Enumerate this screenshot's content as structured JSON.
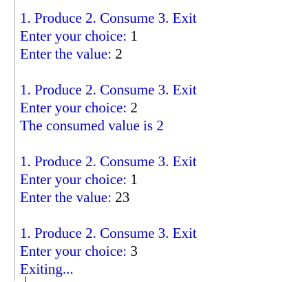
{
  "console": {
    "blocks": [
      {
        "menu": "1. Produce 2. Consume 3. Exit",
        "prompt": "Enter your choice: ",
        "choice": "1",
        "result_label": "Enter the value: ",
        "result_value": "2"
      },
      {
        "menu": "1. Produce 2. Consume 3. Exit",
        "prompt": "Enter your choice: ",
        "choice": "2",
        "result_label": "The consumed value is 2",
        "result_value": ""
      },
      {
        "menu": "1. Produce 2. Consume 3. Exit",
        "prompt": "Enter your choice: ",
        "choice": "1",
        "result_label": "Enter the value: ",
        "result_value": "23"
      },
      {
        "menu": "1. Produce 2. Consume 3. Exit",
        "prompt": "Enter your choice: ",
        "choice": "3",
        "result_label": "Exiting...",
        "result_value": ""
      }
    ]
  },
  "colors": {
    "output_text": "#0000cc",
    "input_text": "#000000",
    "background": "#ffffff"
  }
}
